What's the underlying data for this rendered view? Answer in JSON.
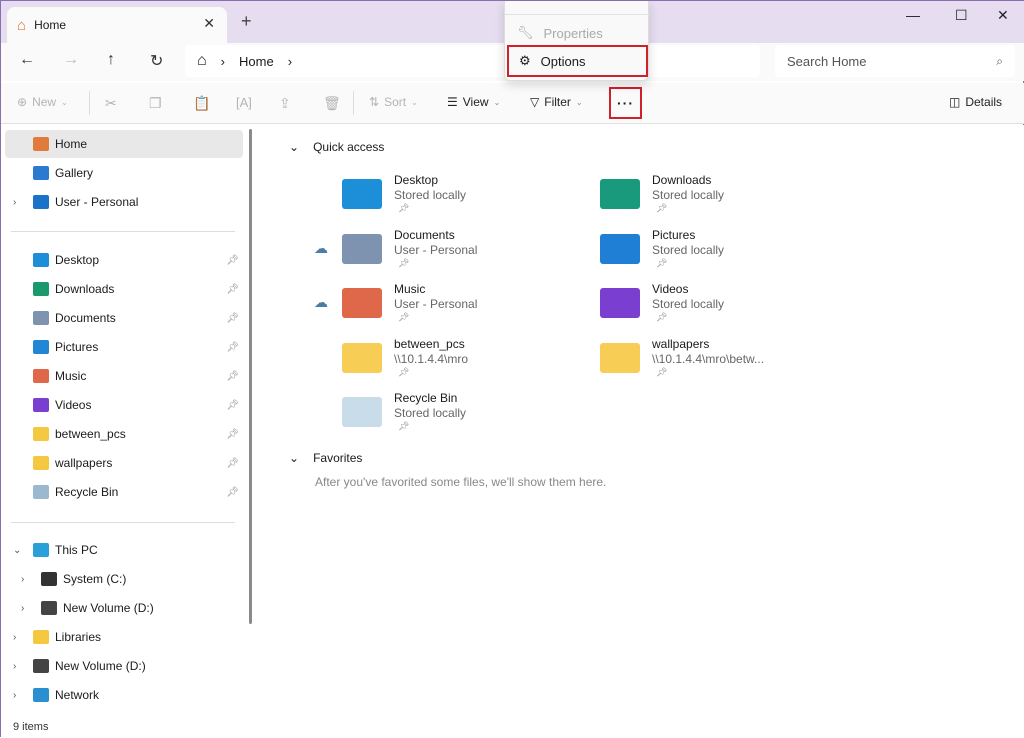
{
  "tab": {
    "title": "Home",
    "close": "✕",
    "new": "+"
  },
  "window": {
    "minimize": "—",
    "maximize": "☐",
    "close": "✕"
  },
  "address": {
    "back": "←",
    "forward": "→",
    "up": "↑",
    "refresh": "↻",
    "home": "⌂",
    "sep": "›",
    "crumb": "Home",
    "search_placeholder": "Search Home",
    "search_icon": "⌕"
  },
  "toolbar": {
    "new": "New",
    "sort": "Sort",
    "view": "View",
    "filter": "Filter",
    "more": "···",
    "details": "Details"
  },
  "menu": {
    "properties": "Properties",
    "options": "Options"
  },
  "sidebar": {
    "top": [
      {
        "label": "Home",
        "icon": "home-icon",
        "color": "#e07b39"
      },
      {
        "label": "Gallery",
        "icon": "gallery-icon",
        "color": "#2a7ad1"
      },
      {
        "label": "User - Personal",
        "icon": "onedrive-icon",
        "color": "#1a73c9",
        "expand": true
      }
    ],
    "pinned": [
      {
        "label": "Desktop",
        "color": "#1c8fd8"
      },
      {
        "label": "Downloads",
        "color": "#1a9a6c"
      },
      {
        "label": "Documents",
        "color": "#7e93b0"
      },
      {
        "label": "Pictures",
        "color": "#2186d4"
      },
      {
        "label": "Music",
        "color": "#e0684a"
      },
      {
        "label": "Videos",
        "color": "#7a3fd0"
      },
      {
        "label": "between_pcs",
        "color": "#f5c842"
      },
      {
        "label": "wallpapers",
        "color": "#f5c842"
      },
      {
        "label": "Recycle Bin",
        "color": "#9bb8d0"
      }
    ],
    "bottom": [
      {
        "label": "This PC",
        "color": "#2a9fd8",
        "expanded": true,
        "indent": 0
      },
      {
        "label": "System (C:)",
        "color": "#333",
        "indent": 1
      },
      {
        "label": "New Volume (D:)",
        "color": "#444",
        "indent": 1
      },
      {
        "label": "Libraries",
        "color": "#f5c842",
        "indent": 0
      },
      {
        "label": "New Volume (D:)",
        "color": "#444",
        "indent": 0
      },
      {
        "label": "Network",
        "color": "#2a8fd0",
        "indent": 0
      }
    ]
  },
  "main": {
    "quick_access": "Quick access",
    "items": [
      {
        "name": "Desktop",
        "sub": "Stored locally",
        "color": "#1c8fd8",
        "cloud": false
      },
      {
        "name": "Downloads",
        "sub": "Stored locally",
        "color": "#1a9a7c",
        "cloud": false
      },
      {
        "name": "Documents",
        "sub": "User - Personal",
        "color": "#7e93b0",
        "cloud": true
      },
      {
        "name": "Pictures",
        "sub": "Stored locally",
        "color": "#1f7fd4",
        "cloud": false
      },
      {
        "name": "Music",
        "sub": "User - Personal",
        "color": "#e0684a",
        "cloud": true
      },
      {
        "name": "Videos",
        "sub": "Stored locally",
        "color": "#7a3fd0",
        "cloud": false
      },
      {
        "name": "between_pcs",
        "sub": "\\\\10.1.4.4\\mro",
        "color": "#f7cd56",
        "cloud": false
      },
      {
        "name": "wallpapers",
        "sub": "\\\\10.1.4.4\\mro\\betw...",
        "color": "#f7cd56",
        "cloud": false
      },
      {
        "name": "Recycle Bin",
        "sub": "Stored locally",
        "color": "#c9dcea",
        "cloud": false
      }
    ],
    "favorites": "Favorites",
    "favorites_empty": "After you've favorited some files, we'll show them here."
  },
  "status": {
    "count": "9 items"
  }
}
